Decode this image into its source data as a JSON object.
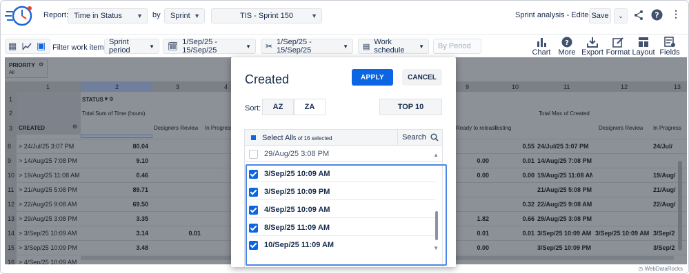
{
  "header": {
    "report_label": "Report:",
    "report_value": "Time in Status",
    "by_label": "by",
    "by_value": "Sprint",
    "sprint_value": "TIS - Sprint 150",
    "analysis_label": "Sprint analysis - Edited",
    "save_label": "Save"
  },
  "toolbar": {
    "filter_label": "Filter work items:",
    "period_value": "Sprint period",
    "date_range_1": "1/Sep/25 - 15/Sep/25",
    "date_range_2": "1/Sep/25 - 15/Sep/25",
    "work_schedule": "Work schedule",
    "by_period": "By Period",
    "tools": [
      "Chart",
      "More info",
      "Export",
      "Format",
      "Layout",
      "Fields"
    ]
  },
  "grid": {
    "priority_label": "PRIORITY",
    "priority_sub": "All",
    "col_numbers": [
      "1",
      "2",
      "3",
      "4",
      "9",
      "10",
      "11",
      "12",
      "13"
    ],
    "status_label": "STATUS",
    "measure_1": "Total Sum of Time (hours)",
    "measure_2": "Total Max of Created",
    "created_label": "CREATED",
    "sub_headers": [
      "Designers Review",
      "In Progress",
      "Ready to release",
      "Testing",
      "Designers Review",
      "In Progress"
    ],
    "row_numbers": [
      "1",
      "2",
      "3",
      "8",
      "9",
      "10",
      "11",
      "12",
      "13",
      "14",
      "15",
      "16"
    ],
    "rows": [
      {
        "label": "> 24/Jul/25 3:07 PM",
        "v2": "80.04",
        "v3": "",
        "v9": "",
        "v10": "0.55",
        "v11": "24/Jul/25 3:07 PM",
        "v12": "",
        "v13": "24/Jul/"
      },
      {
        "label": "> 14/Aug/25 7:08 PM",
        "v2": "9.10",
        "v3": "",
        "v9": "0.00",
        "v10": "0.01",
        "v11": "14/Aug/25 7:08 PM",
        "v12": "",
        "v13": ""
      },
      {
        "label": "> 19/Aug/25 11:08 AM",
        "v2": "0.46",
        "v3": "",
        "v9": "0.00",
        "v10": "0.00",
        "v11": "19/Aug/25 11:08 AM",
        "v12": "",
        "v13": "19/Aug/"
      },
      {
        "label": "> 21/Aug/25 5:08 PM",
        "v2": "89.71",
        "v3": "",
        "v9": "",
        "v10": "",
        "v11": "21/Aug/25 5:08 PM",
        "v12": "",
        "v13": "21/Aug/"
      },
      {
        "label": "> 22/Aug/25 9:08 AM",
        "v2": "69.50",
        "v3": "",
        "v9": "",
        "v10": "0.32",
        "v11": "22/Aug/25 9:08 AM",
        "v12": "",
        "v13": "22/Aug/"
      },
      {
        "label": "> 29/Aug/25 3:08 PM",
        "v2": "3.35",
        "v3": "",
        "v9": "1.82",
        "v10": "0.66",
        "v11": "29/Aug/25 3:08 PM",
        "v12": "",
        "v13": ""
      },
      {
        "label": "> 3/Sep/25 10:09 AM",
        "v2": "3.14",
        "v3": "0.01",
        "v9": "0.01",
        "v10": "0.01",
        "v11": "3/Sep/25 10:09 AM",
        "v12": "3/Sep/25 10:09 AM",
        "v13": "3/Sep/2"
      },
      {
        "label": "> 3/Sep/25 10:09 PM",
        "v2": "3.48",
        "v3": "",
        "v9": "0.00",
        "v10": "",
        "v11": "3/Sep/25 10:09 PM",
        "v12": "",
        "v13": "3/Sep/2"
      },
      {
        "label": "> 4/Sep/25 10:09 AM",
        "v2": "",
        "v3": "",
        "v9": "",
        "v10": "",
        "v11": "",
        "v12": "",
        "v13": ""
      }
    ]
  },
  "modal": {
    "title": "Created",
    "apply_label": "APPLY",
    "cancel_label": "CANCEL",
    "sort_label": "Sort:",
    "sort_az": "AZ",
    "sort_za": "ZA",
    "top10_label": "TOP 10",
    "select_all_label": "Select All",
    "selected_count": "5 of 16 selected",
    "search_label": "Search",
    "items": [
      {
        "label": "29/Aug/25 3:08 PM",
        "checked": false
      },
      {
        "label": "3/Sep/25 10:09 AM",
        "checked": true
      },
      {
        "label": "3/Sep/25 10:09 PM",
        "checked": true
      },
      {
        "label": "4/Sep/25 10:09 AM",
        "checked": true
      },
      {
        "label": "8/Sep/25 11:09 AM",
        "checked": true
      },
      {
        "label": "10/Sep/25 11:09 AM",
        "checked": true
      }
    ]
  },
  "watermark": "WebDataRocks",
  "colors": {
    "accent": "#0c66e4",
    "overlay": "#8c9097",
    "highlight": "#4a86e8"
  }
}
